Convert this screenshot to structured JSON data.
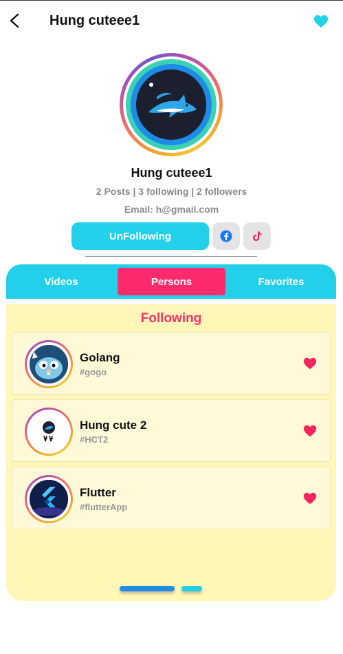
{
  "header": {
    "title": "Hung cuteee1"
  },
  "profile": {
    "name": "Hung cuteee1",
    "stats": "2 Posts | 3 following | 2 followers",
    "email": "Email: h@gmail.com",
    "unfollow_label": "UnFollowing"
  },
  "tabs": [
    {
      "label": "Videos"
    },
    {
      "label": "Persons"
    },
    {
      "label": "Favorites"
    }
  ],
  "following": {
    "title": "Following",
    "items": [
      {
        "name": "Golang",
        "tag": "#gogo"
      },
      {
        "name": "Hung cute 2",
        "tag": "#HCT2"
      },
      {
        "name": "Flutter",
        "tag": "#flutterApp"
      }
    ]
  },
  "colors": {
    "accent": "#22d0ea",
    "pink": "#fd2b6e",
    "panel_bg": "#fff7b8"
  },
  "icons": [
    "back-arrow-icon",
    "heart-icon",
    "facebook-icon",
    "tiktok-icon"
  ]
}
